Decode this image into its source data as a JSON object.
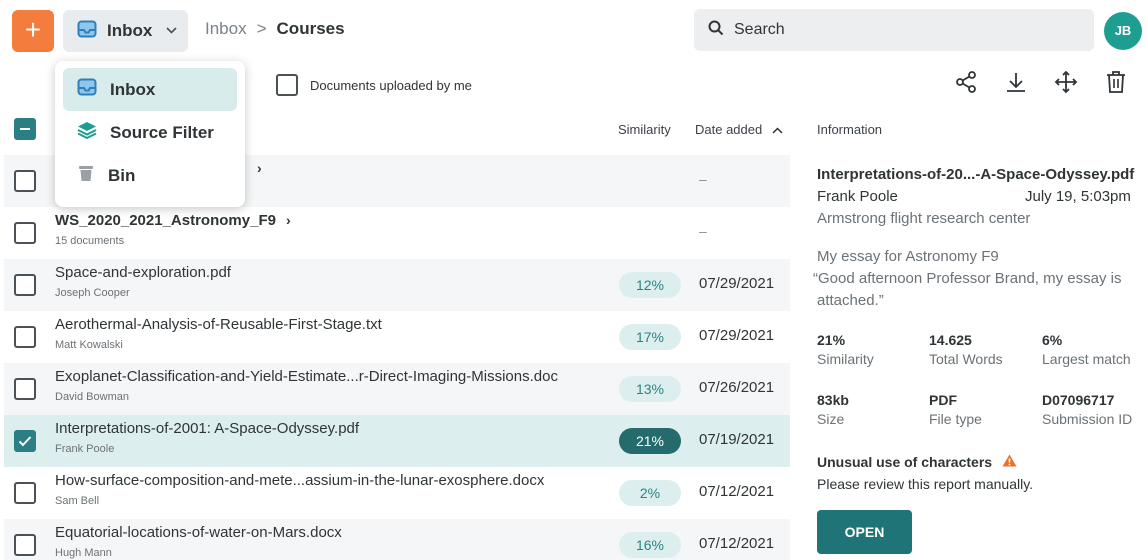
{
  "top": {
    "add_label": "+",
    "inbox_label": "Inbox",
    "breadcrumb": {
      "parent": "Inbox",
      "sep": ">",
      "current": "Courses"
    },
    "search_label": "Search",
    "avatar_initials": "JB"
  },
  "menu": {
    "items": [
      {
        "label": "Inbox",
        "icon": "inbox-icon"
      },
      {
        "label": "Source Filter",
        "icon": "layers-icon"
      },
      {
        "label": "Bin",
        "icon": "bin-icon"
      }
    ]
  },
  "filter": {
    "label": "Documents uploaded by me"
  },
  "table": {
    "col_similarity": "Similarity",
    "col_date": "Date added",
    "sort_icon": "^",
    "rows": [
      {
        "title": "",
        "sub": "",
        "similarity": "",
        "date": "–"
      },
      {
        "title": "WS_2020_2021_Astronomy_F9",
        "sub": "15 documents",
        "similarity": "",
        "date": "–"
      },
      {
        "title": "Space-and-exploration.pdf",
        "sub": "Joseph Cooper",
        "similarity": "12%",
        "date": "07/29/2021"
      },
      {
        "title": "Aerothermal-Analysis-of-Reusable-First-Stage.txt",
        "sub": "Matt Kowalski",
        "similarity": "17%",
        "date": "07/29/2021"
      },
      {
        "title": "Exoplanet-Classification-and-Yield-Estimate...r-Direct-Imaging-Missions.doc",
        "sub": "David Bowman",
        "similarity": "13%",
        "date": "07/26/2021"
      },
      {
        "title": "Interpretations-of-2001: A-Space-Odyssey.pdf",
        "sub": "Frank Poole",
        "similarity": "21%",
        "date": "07/19/2021"
      },
      {
        "title": "How-surface-composition-and-mete...assium-in-the-lunar-exosphere.docx",
        "sub": "Sam Bell",
        "similarity": "2%",
        "date": "07/12/2021"
      },
      {
        "title": "Equatorial-locations-of-water-on-Mars.docx",
        "sub": "Hugh Mann",
        "similarity": "16%",
        "date": "07/12/2021"
      }
    ]
  },
  "info": {
    "header": "Information",
    "filename": "Interpretations-of-20...-A-Space-Odyssey.pdf",
    "author": "Frank Poole",
    "datetime": "July 19, 5:03pm",
    "organization": "Armstrong flight research center",
    "essay_title": "My essay for Astronomy F9",
    "message_1": "“Good afternoon Professor Brand, my essay is",
    "message_2": "attached.”",
    "stats": [
      {
        "value": "21%",
        "label": "Similarity"
      },
      {
        "value": "14.625",
        "label": "Total Words"
      },
      {
        "value": "6%",
        "label": "Largest match"
      },
      {
        "value": "83kb",
        "label": "Size"
      },
      {
        "value": "PDF",
        "label": "File type"
      },
      {
        "value": "D07096717",
        "label": "Submission ID"
      }
    ],
    "warning_title": "Unusual use of characters",
    "warning_text": "Please review this report manually.",
    "open_label": "OPEN"
  },
  "colors": {
    "accent_orange": "#f47c3c",
    "teal": "#1f7478",
    "pill_bg": "#dcefee",
    "warning": "#e8722c"
  }
}
